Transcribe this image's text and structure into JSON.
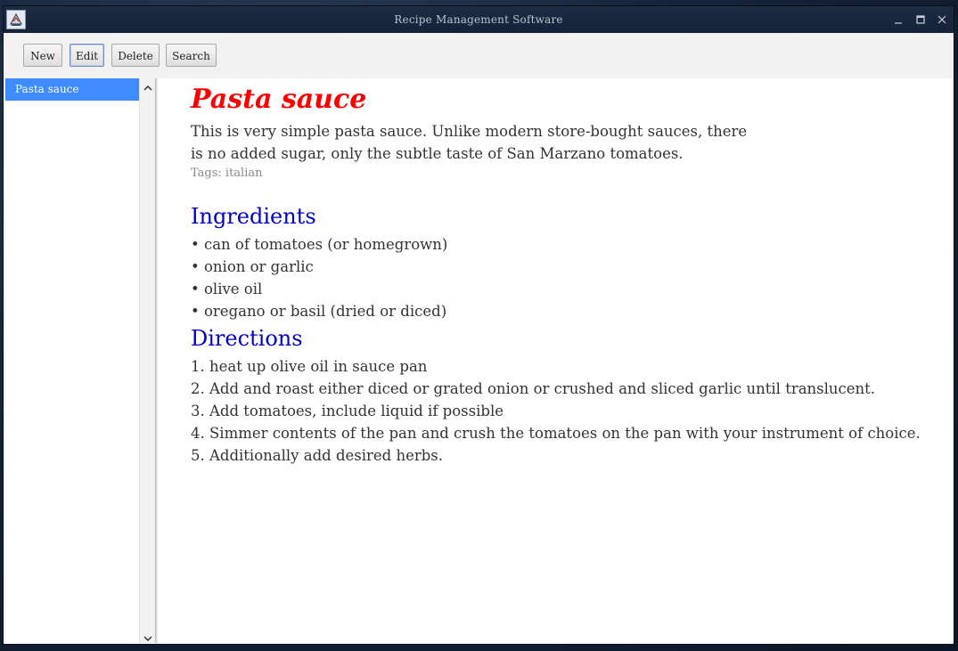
{
  "window": {
    "title": "Recipe Management Software",
    "app_icon": "java-app-icon"
  },
  "toolbar": {
    "new_label": "New",
    "edit_label": "Edit",
    "delete_label": "Delete",
    "search_label": "Search"
  },
  "sidebar": {
    "items": [
      {
        "label": "Pasta sauce",
        "selected": true
      }
    ]
  },
  "recipe": {
    "title": "Pasta sauce",
    "description": "This is very simple pasta sauce. Unlike modern store-bought sauces, there is no added sugar, only the subtle taste of San Marzano tomatoes.",
    "tags": "Tags: italian",
    "ingredients_heading": "Ingredients",
    "ingredients": [
      "• can of tomatoes (or homegrown)",
      "• onion or garlic",
      "• olive oil",
      "• oregano or basil (dried or diced)"
    ],
    "directions_heading": "Directions",
    "directions": [
      "1. heat up olive oil in sauce pan",
      "2. Add and roast either diced or grated onion or crushed and sliced garlic until translucent.",
      "3. Add tomatoes, include liquid if possible",
      "4. Simmer contents of the pan and crush the tomatoes on the pan with your instrument of choice.",
      "5. Additionally add desired herbs."
    ]
  },
  "colors": {
    "title_red": "#ff0000",
    "heading_blue": "#0000cc",
    "selection_blue": "#3d8bff",
    "tags_gray": "#888888"
  }
}
